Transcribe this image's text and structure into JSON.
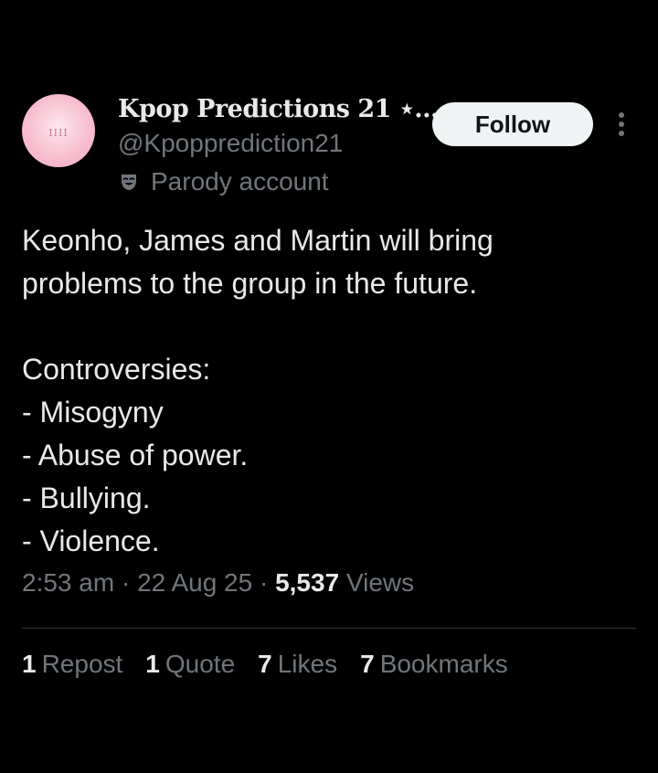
{
  "author": {
    "display_name": "Kpop Predictions 21 ⋆...",
    "handle": "@Kpopprediction21",
    "label": "Parody account",
    "avatar_text": "IIII"
  },
  "follow_button": {
    "label": "Follow"
  },
  "more_button": {
    "icon": "more-vertical-icon"
  },
  "tweet": {
    "lines": [
      "Keonho, James and Martin will bring",
      "problems to the group in the future.",
      "",
      "Controversies:",
      "- Misogyny",
      "- Abuse of power.",
      "- Bullying.",
      "- Violence."
    ]
  },
  "meta": {
    "time": "2:53 am",
    "separator": "·",
    "date": "22 Aug 25",
    "views_count": "5,537",
    "views_label": "Views"
  },
  "stats": {
    "reposts": {
      "count": "1",
      "label": "Repost"
    },
    "quotes": {
      "count": "1",
      "label": "Quote"
    },
    "likes": {
      "count": "7",
      "label": "Likes"
    },
    "bookmarks": {
      "count": "7",
      "label": "Bookmarks"
    }
  },
  "colors": {
    "background": "#000000",
    "primary_text": "#e7e9ea",
    "secondary_text": "#71767b",
    "follow_bg": "#eff3f4",
    "divider": "#2f3336"
  }
}
